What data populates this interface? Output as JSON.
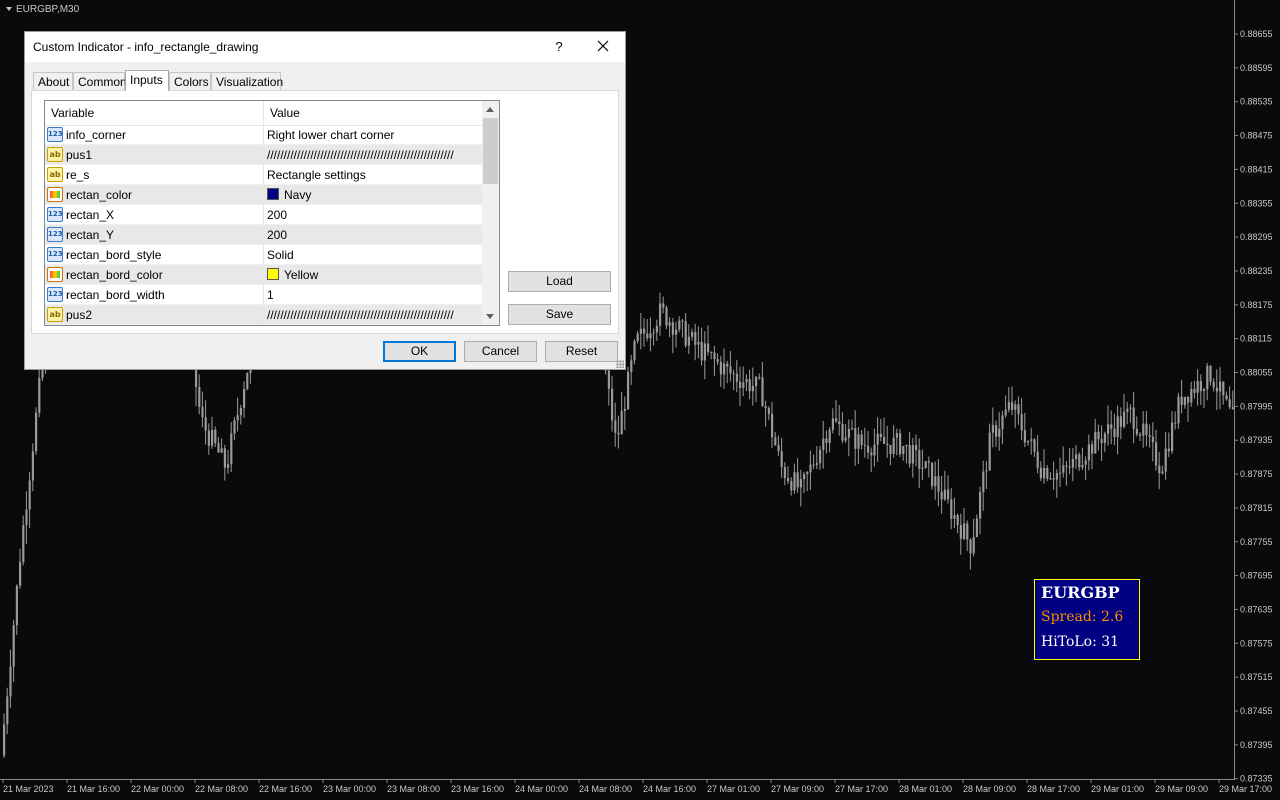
{
  "chart": {
    "symbol_label": "EURGBP,M30",
    "price_ticks": [
      "0.88655",
      "0.88595",
      "0.88535",
      "0.88475",
      "0.88415",
      "0.88355",
      "0.88295",
      "0.88235",
      "0.88175",
      "0.88115",
      "0.88055",
      "0.87995",
      "0.87935",
      "0.87875",
      "0.87815",
      "0.87755",
      "0.87695",
      "0.87635",
      "0.87575",
      "0.87515",
      "0.87455",
      "0.87395",
      "0.87335"
    ],
    "time_ticks": [
      "21 Mar 2023",
      "21 Mar 16:00",
      "22 Mar 00:00",
      "22 Mar 08:00",
      "22 Mar 16:00",
      "23 Mar 00:00",
      "23 Mar 08:00",
      "23 Mar 16:00",
      "24 Mar 00:00",
      "24 Mar 08:00",
      "24 Mar 16:00",
      "27 Mar 01:00",
      "27 Mar 09:00",
      "27 Mar 17:00",
      "28 Mar 01:00",
      "28 Mar 09:00",
      "28 Mar 17:00",
      "29 Mar 01:00",
      "29 Mar 09:00",
      "29 Mar 17:00"
    ],
    "colors": {
      "background": "#0a0a0d",
      "candle": "#9a9a9a",
      "axis_text": "#c8c8c8"
    }
  },
  "info_rect": {
    "symbol": "EURGBP",
    "spread": "Spread: 2.6",
    "hitolo": "HiToLo: 31",
    "colors": {
      "fill": "#000080",
      "border": "#ffff00",
      "spread_text": "#ff8c00",
      "text": "#ffffff"
    }
  },
  "dialog": {
    "title": "Custom Indicator - info_rectangle_drawing",
    "help": "?",
    "tabs": [
      "About",
      "Common",
      "Inputs",
      "Colors",
      "Visualization"
    ],
    "active_tab": "Inputs",
    "columns": [
      "Variable",
      "Value"
    ],
    "rows": [
      {
        "icon": "num",
        "icon_text": "123",
        "variable": "info_corner",
        "value": "Right lower chart corner"
      },
      {
        "icon": "str",
        "icon_text": "ab",
        "variable": "pus1",
        "value": "////////////////////////////////////////////////////////"
      },
      {
        "icon": "str",
        "icon_text": "ab",
        "variable": "re_s",
        "value": "Rectangle settings"
      },
      {
        "icon": "col",
        "icon_text": "",
        "variable": "rectan_color",
        "value": "Navy",
        "swatch": "#000080"
      },
      {
        "icon": "num",
        "icon_text": "123",
        "variable": "rectan_X",
        "value": "200"
      },
      {
        "icon": "num",
        "icon_text": "123",
        "variable": "rectan_Y",
        "value": "200"
      },
      {
        "icon": "num",
        "icon_text": "123",
        "variable": "rectan_bord_style",
        "value": "Solid"
      },
      {
        "icon": "col",
        "icon_text": "",
        "variable": "rectan_bord_color",
        "value": "Yellow",
        "swatch": "#ffff00"
      },
      {
        "icon": "num",
        "icon_text": "123",
        "variable": "rectan_bord_width",
        "value": "1"
      },
      {
        "icon": "str",
        "icon_text": "ab",
        "variable": "pus2",
        "value": "////////////////////////////////////////////////////////"
      }
    ],
    "side_buttons": {
      "load": "Load",
      "save": "Save"
    },
    "footer_buttons": {
      "ok": "OK",
      "cancel": "Cancel",
      "reset": "Reset"
    }
  }
}
